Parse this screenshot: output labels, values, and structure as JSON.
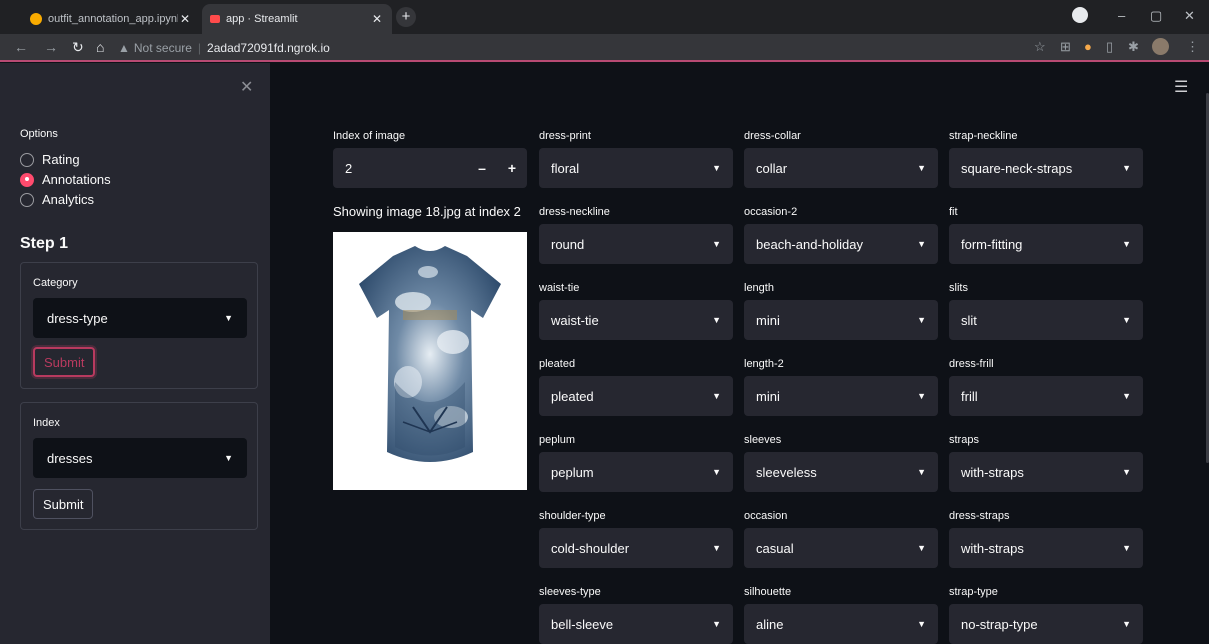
{
  "browser": {
    "tabs": [
      {
        "title": "outfit_annotation_app.ipynb - Co",
        "active": false
      },
      {
        "title": "app · Streamlit",
        "active": true
      }
    ],
    "new_tab": "+",
    "url": {
      "security": "Not secure",
      "domain": "2adad72091fd.ngrok.io"
    }
  },
  "sidebar": {
    "options_label": "Options",
    "radio": [
      {
        "label": "Rating",
        "selected": false
      },
      {
        "label": "Annotations",
        "selected": true
      },
      {
        "label": "Analytics",
        "selected": false
      }
    ],
    "step_title": "Step 1",
    "category": {
      "label": "Category",
      "value": "dress-type",
      "button": "Submit"
    },
    "index": {
      "label": "Index",
      "value": "dresses",
      "button": "Submit"
    }
  },
  "main": {
    "index_label": "Index of image",
    "index_value": "2",
    "caption": "Showing image 18.jpg at index 2",
    "columns": [
      [
        {
          "label": "dress-print",
          "value": "floral"
        },
        {
          "label": "dress-neckline",
          "value": "round"
        },
        {
          "label": "waist-tie",
          "value": "waist-tie"
        },
        {
          "label": "pleated",
          "value": "pleated"
        },
        {
          "label": "peplum",
          "value": "peplum"
        },
        {
          "label": "shoulder-type",
          "value": "cold-shoulder"
        },
        {
          "label": "sleeves-type",
          "value": "bell-sleeve"
        }
      ],
      [
        {
          "label": "dress-collar",
          "value": "collar"
        },
        {
          "label": "occasion-2",
          "value": "beach-and-holiday"
        },
        {
          "label": "length",
          "value": "mini"
        },
        {
          "label": "length-2",
          "value": "mini"
        },
        {
          "label": "sleeves",
          "value": "sleeveless"
        },
        {
          "label": "occasion",
          "value": "casual"
        },
        {
          "label": "silhouette",
          "value": "aline"
        }
      ],
      [
        {
          "label": "strap-neckline",
          "value": "square-neck-straps"
        },
        {
          "label": "fit",
          "value": "form-fitting"
        },
        {
          "label": "slits",
          "value": "slit"
        },
        {
          "label": "dress-frill",
          "value": "frill"
        },
        {
          "label": "straps",
          "value": "with-straps"
        },
        {
          "label": "dress-straps",
          "value": "with-straps"
        },
        {
          "label": "strap-type",
          "value": "no-strap-type"
        }
      ]
    ]
  },
  "colors": {
    "accent": "#ff4b6e",
    "sidebar_bg": "#262730",
    "main_bg": "#0e1117",
    "widget_bg": "#262730"
  }
}
